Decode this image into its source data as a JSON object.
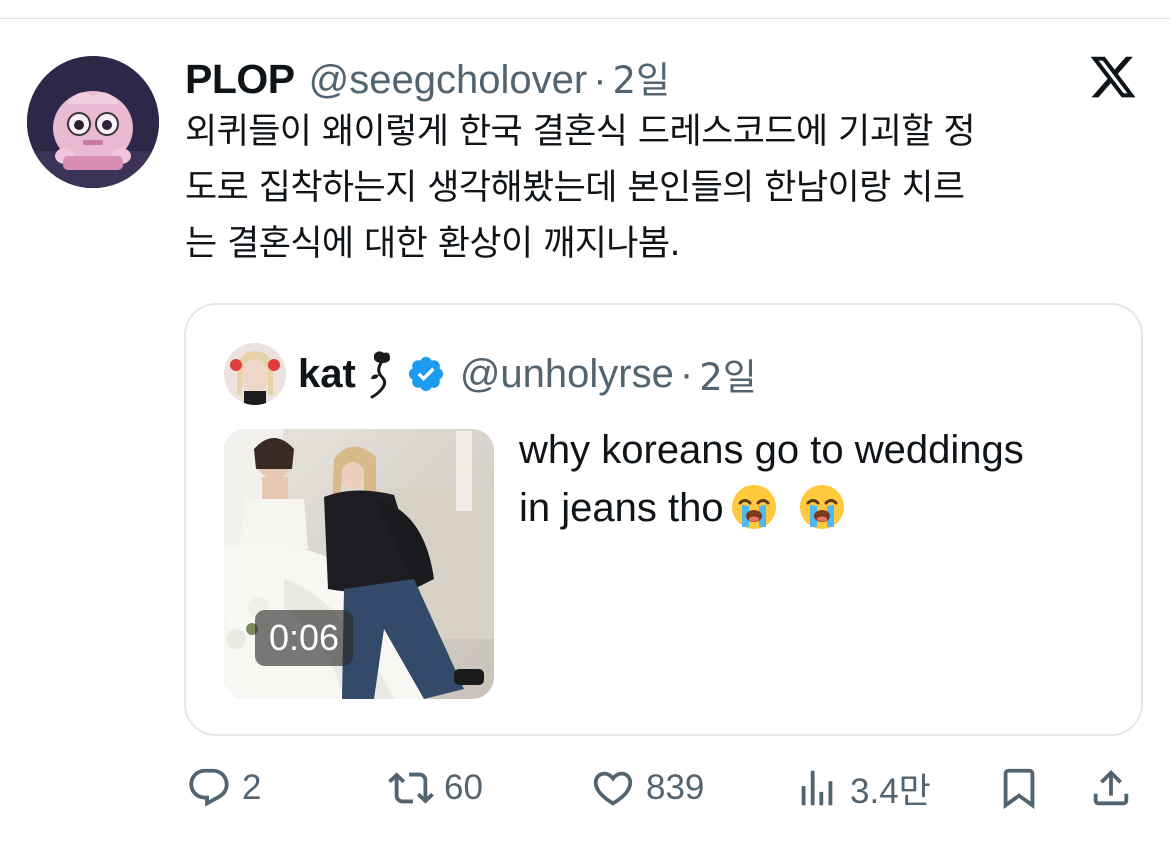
{
  "tweet": {
    "display_name": "PLOP",
    "handle": "@seegcholover",
    "separator": "·",
    "time": "2일",
    "text_lines": [
      "외퀴들이 왜이렇게 한국 결혼식 드레스코드에 기괴할 정",
      "도로 집착하는지 생각해봤는데 본인들의 한남이랑 치르",
      "는 결혼식에 대한 환상이 깨지나봄."
    ]
  },
  "quote": {
    "display_name": "kat",
    "handle": "@unholyrse",
    "separator": "·",
    "time": "2일",
    "text_line1": "why koreans go to weddings",
    "text_line2": "in jeans tho",
    "video_duration": "0:06"
  },
  "actions": {
    "replies": "2",
    "retweets": "60",
    "likes": "839",
    "views": "3.4만"
  },
  "icons": {
    "brand": "x-logo-icon",
    "verified": "verified-badge-icon",
    "emoji": "loudly-crying-face-icon"
  },
  "colors": {
    "text": "#0f1419",
    "secondary": "#536471",
    "verified": "#1d9bf0",
    "border": "#e4e8eb"
  }
}
